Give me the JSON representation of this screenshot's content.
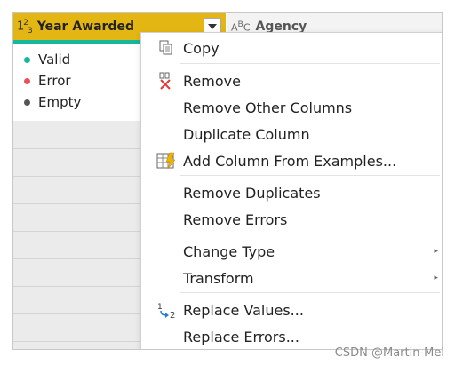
{
  "columns": {
    "year": {
      "type_icon": "1²₃",
      "label": "Year Awarded"
    },
    "agency": {
      "type_icon": "ABC",
      "label": "Agency"
    }
  },
  "quality": [
    {
      "label": "Valid",
      "color": "#16b79c"
    },
    {
      "label": "Error",
      "color": "#e8505b"
    },
    {
      "label": "Empty",
      "color": "#555555"
    }
  ],
  "menu": {
    "copy": "Copy",
    "remove": "Remove",
    "remove_other": "Remove Other Columns",
    "duplicate": "Duplicate Column",
    "add_from_examples": "Add Column From Examples...",
    "remove_duplicates": "Remove Duplicates",
    "remove_errors": "Remove Errors",
    "change_type": "Change Type",
    "transform": "Transform",
    "replace_values": "Replace Values...",
    "replace_errors": "Replace Errors..."
  },
  "watermark": "CSDN @Martin-Mei"
}
